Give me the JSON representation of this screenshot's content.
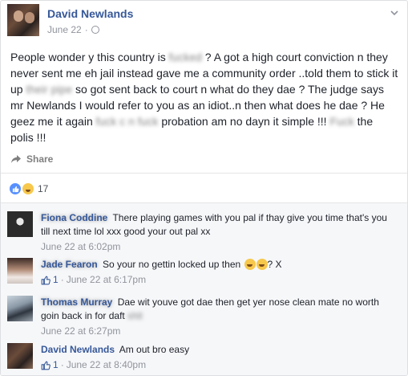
{
  "post": {
    "author": "David Newlands",
    "date": "June 22",
    "separator": "·",
    "text_parts": [
      {
        "t": "People wonder y this country is ",
        "blur": false
      },
      {
        "t": "fucked",
        "blur": true
      },
      {
        "t": " ? A got a high court conviction n they never sent me eh jail instead gave me a community order ..told them to stick it up ",
        "blur": false
      },
      {
        "t": "their pipe",
        "blur": true
      },
      {
        "t": " so got sent back to court n what do they dae ? The judge says mr Newlands I would refer to you as an idiot..n then what does he dae ? He geez me it again ",
        "blur": false
      },
      {
        "t": "fuck c n fuck",
        "blur": true
      },
      {
        "t": " probation am no dayn it simple !!! ",
        "blur": false
      },
      {
        "t": "Fuck",
        "blur": true
      },
      {
        "t": " the polis !!!",
        "blur": false
      }
    ],
    "share_label": "Share",
    "reaction_count": "17"
  },
  "comments": [
    {
      "name": "Fiona Coddine",
      "name_blurred": true,
      "text": "There playing games with you pal if thay give you time that's you till next time lol xxx good your out pal xx",
      "likes": "",
      "time": "June 22 at 6:02pm"
    },
    {
      "name": "Jade Fearon",
      "name_blurred": true,
      "text": "So your no gettin locked up then",
      "text_suffix": "? X",
      "likes": "1",
      "time": "June 22 at 6:17pm"
    },
    {
      "name": "Thomas Murray",
      "name_blurred": true,
      "text": "Dae wit youve got dae then get yer nose clean mate no worth goin back in for daft",
      "text_blur_tail": "shit",
      "likes": "",
      "time": "June 22 at 6:27pm"
    },
    {
      "name": "David Newlands",
      "name_blurred": false,
      "text": "Am out bro easy",
      "likes": "1",
      "time": "June 22 at 8:40pm"
    }
  ],
  "colors": {
    "link": "#365899",
    "meta": "#90949c",
    "like_blue": "#5890ff"
  }
}
